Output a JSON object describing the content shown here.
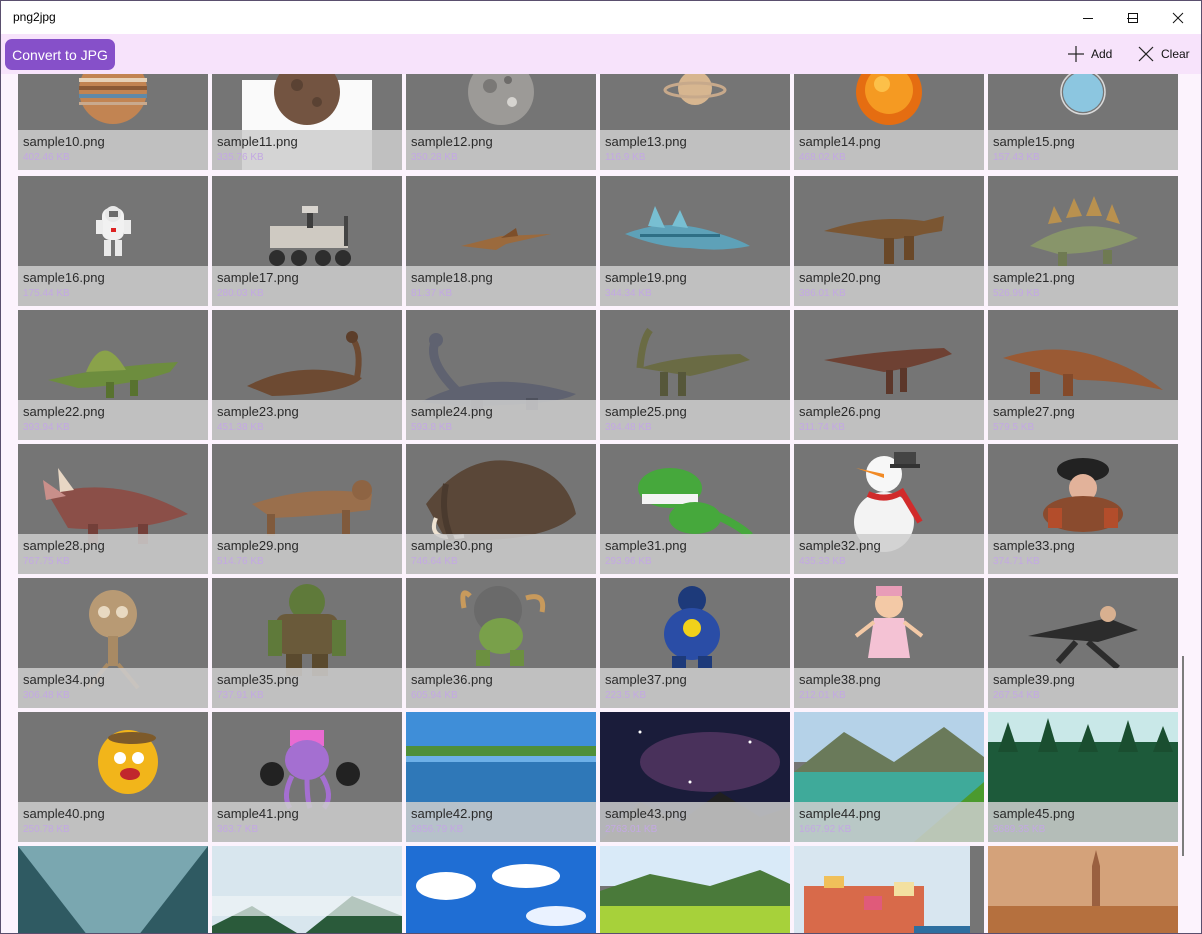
{
  "window": {
    "title": "png2jpg"
  },
  "toolbar": {
    "convert_label": "Convert to JPG",
    "add_label": "Add",
    "clear_label": "Clear"
  },
  "colors": {
    "accent": "#8650c9",
    "toolbar_bg": "#f7e3fb",
    "tile_bg": "#757575",
    "size_text": "#c3a8e3"
  },
  "items": [
    {
      "name": "sample10.png",
      "size": "402.46 KB",
      "thumb": "planet"
    },
    {
      "name": "sample11.png",
      "size": "335.76 KB",
      "thumb": "moon-white"
    },
    {
      "name": "sample12.png",
      "size": "350.28 KB",
      "thumb": "moon"
    },
    {
      "name": "sample13.png",
      "size": "116.9 KB",
      "thumb": "saturn"
    },
    {
      "name": "sample14.png",
      "size": "468.02 KB",
      "thumb": "sun"
    },
    {
      "name": "sample15.png",
      "size": "157.43 KB",
      "thumb": "neptune"
    },
    {
      "name": "sample16.png",
      "size": "175.44 KB",
      "thumb": "astronaut"
    },
    {
      "name": "sample17.png",
      "size": "280.03 KB",
      "thumb": "rover"
    },
    {
      "name": "sample18.png",
      "size": "81.37 KB",
      "thumb": "pterosaur"
    },
    {
      "name": "sample19.png",
      "size": "344.34 KB",
      "thumb": "sea-reptile"
    },
    {
      "name": "sample20.png",
      "size": "386.01 KB",
      "thumb": "t-rex"
    },
    {
      "name": "sample21.png",
      "size": "526.99 KB",
      "thumb": "stegosaurus"
    },
    {
      "name": "sample22.png",
      "size": "393.94 KB",
      "thumb": "spinosaurus"
    },
    {
      "name": "sample23.png",
      "size": "451.38 KB",
      "thumb": "ankylosaurus"
    },
    {
      "name": "sample24.png",
      "size": "593.8 KB",
      "thumb": "sauropod"
    },
    {
      "name": "sample25.png",
      "size": "394.48 KB",
      "thumb": "dilophosaurus"
    },
    {
      "name": "sample26.png",
      "size": "311.74 KB",
      "thumb": "raptor"
    },
    {
      "name": "sample27.png",
      "size": "579.5 KB",
      "thumb": "dinosaur"
    },
    {
      "name": "sample28.png",
      "size": "767.75 KB",
      "thumb": "triceratops"
    },
    {
      "name": "sample29.png",
      "size": "514.76 KB",
      "thumb": "sabertooth"
    },
    {
      "name": "sample30.png",
      "size": "746.64 KB",
      "thumb": "mammoth"
    },
    {
      "name": "sample31.png",
      "size": "293.96 KB",
      "thumb": "cartoon-dino"
    },
    {
      "name": "sample32.png",
      "size": "435.33 KB",
      "thumb": "snowman"
    },
    {
      "name": "sample33.png",
      "size": "374.71 KB",
      "thumb": "pirate"
    },
    {
      "name": "sample34.png",
      "size": "306.48 KB",
      "thumb": "mummy"
    },
    {
      "name": "sample35.png",
      "size": "737.91 KB",
      "thumb": "orc"
    },
    {
      "name": "sample36.png",
      "size": "605.94 KB",
      "thumb": "goblin"
    },
    {
      "name": "sample37.png",
      "size": "223.5 KB",
      "thumb": "superhero"
    },
    {
      "name": "sample38.png",
      "size": "212.01 KB",
      "thumb": "doll"
    },
    {
      "name": "sample39.png",
      "size": "267.54 KB",
      "thumb": "ninja"
    },
    {
      "name": "sample40.png",
      "size": "250.78 KB",
      "thumb": "cartoon-cowboy"
    },
    {
      "name": "sample41.png",
      "size": "363.7 KB",
      "thumb": "octopus-dj"
    },
    {
      "name": "sample42.png",
      "size": "2856.79 KB",
      "thumb": "lake"
    },
    {
      "name": "sample43.png",
      "size": "2763.01 KB",
      "thumb": "night-sky"
    },
    {
      "name": "sample44.png",
      "size": "1667.92 KB",
      "thumb": "mountain-lake"
    },
    {
      "name": "sample45.png",
      "size": "3689.35 KB",
      "thumb": "forest"
    },
    {
      "name": "",
      "size": "",
      "thumb": "fjord"
    },
    {
      "name": "",
      "size": "",
      "thumb": "misty-forest"
    },
    {
      "name": "",
      "size": "",
      "thumb": "blue-sky"
    },
    {
      "name": "",
      "size": "",
      "thumb": "meadow"
    },
    {
      "name": "",
      "size": "",
      "thumb": "coastal-village"
    },
    {
      "name": "",
      "size": "",
      "thumb": "old-town"
    }
  ]
}
